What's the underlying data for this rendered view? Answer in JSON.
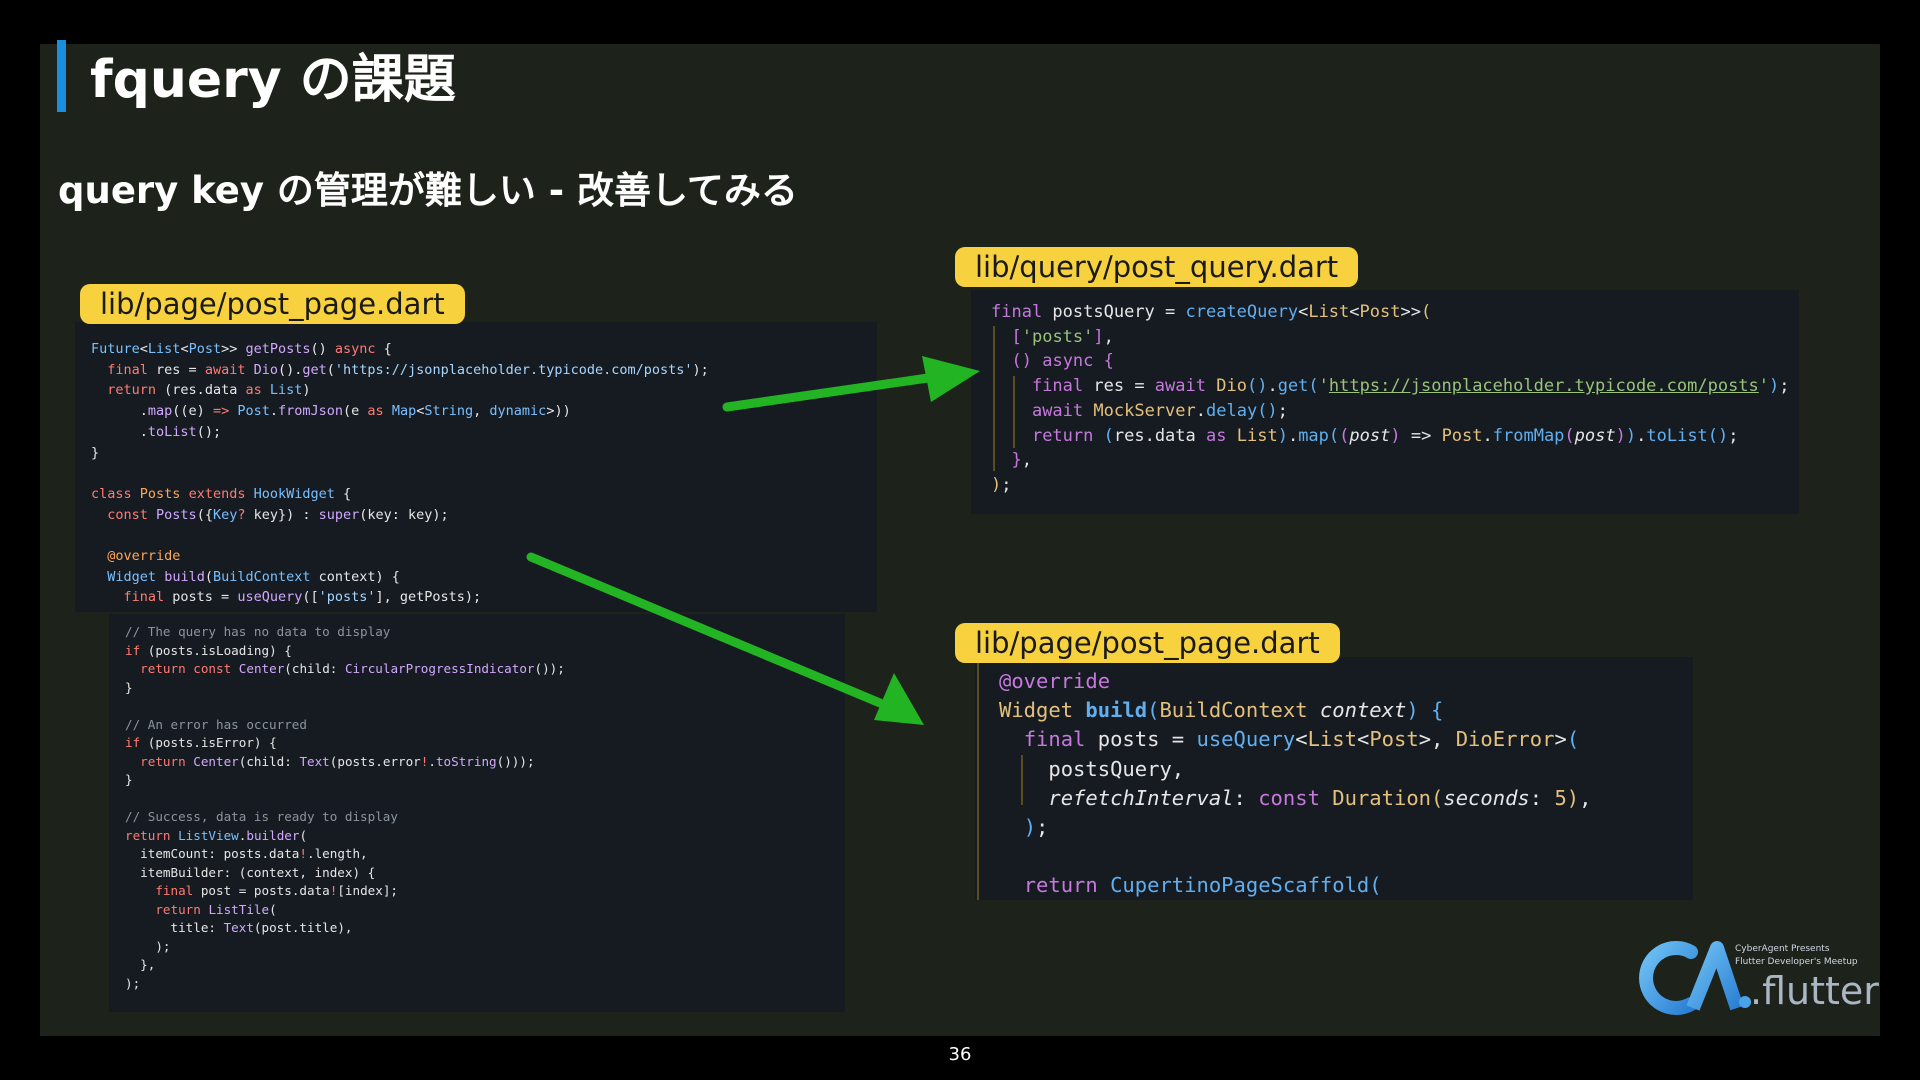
{
  "slide": {
    "title": "fquery の課題",
    "subtitle": "query key の管理が難しい - 改善してみる",
    "page_number": "36"
  },
  "labels": {
    "left_file": "lib/page/post_page.dart",
    "top_right_file": "lib/query/post_query.dart",
    "bottom_right_file": "lib/page/post_page.dart"
  },
  "logo": {
    "line1": "CyberAgent Presents",
    "line2": "Flutter Developer's Meetup",
    "wordmark": ".flutter"
  },
  "colors": {
    "background": "#1d221b",
    "title_accent": "#1a8fe0",
    "label_bg": "#f7d23e",
    "arrow": "#22b422"
  }
}
